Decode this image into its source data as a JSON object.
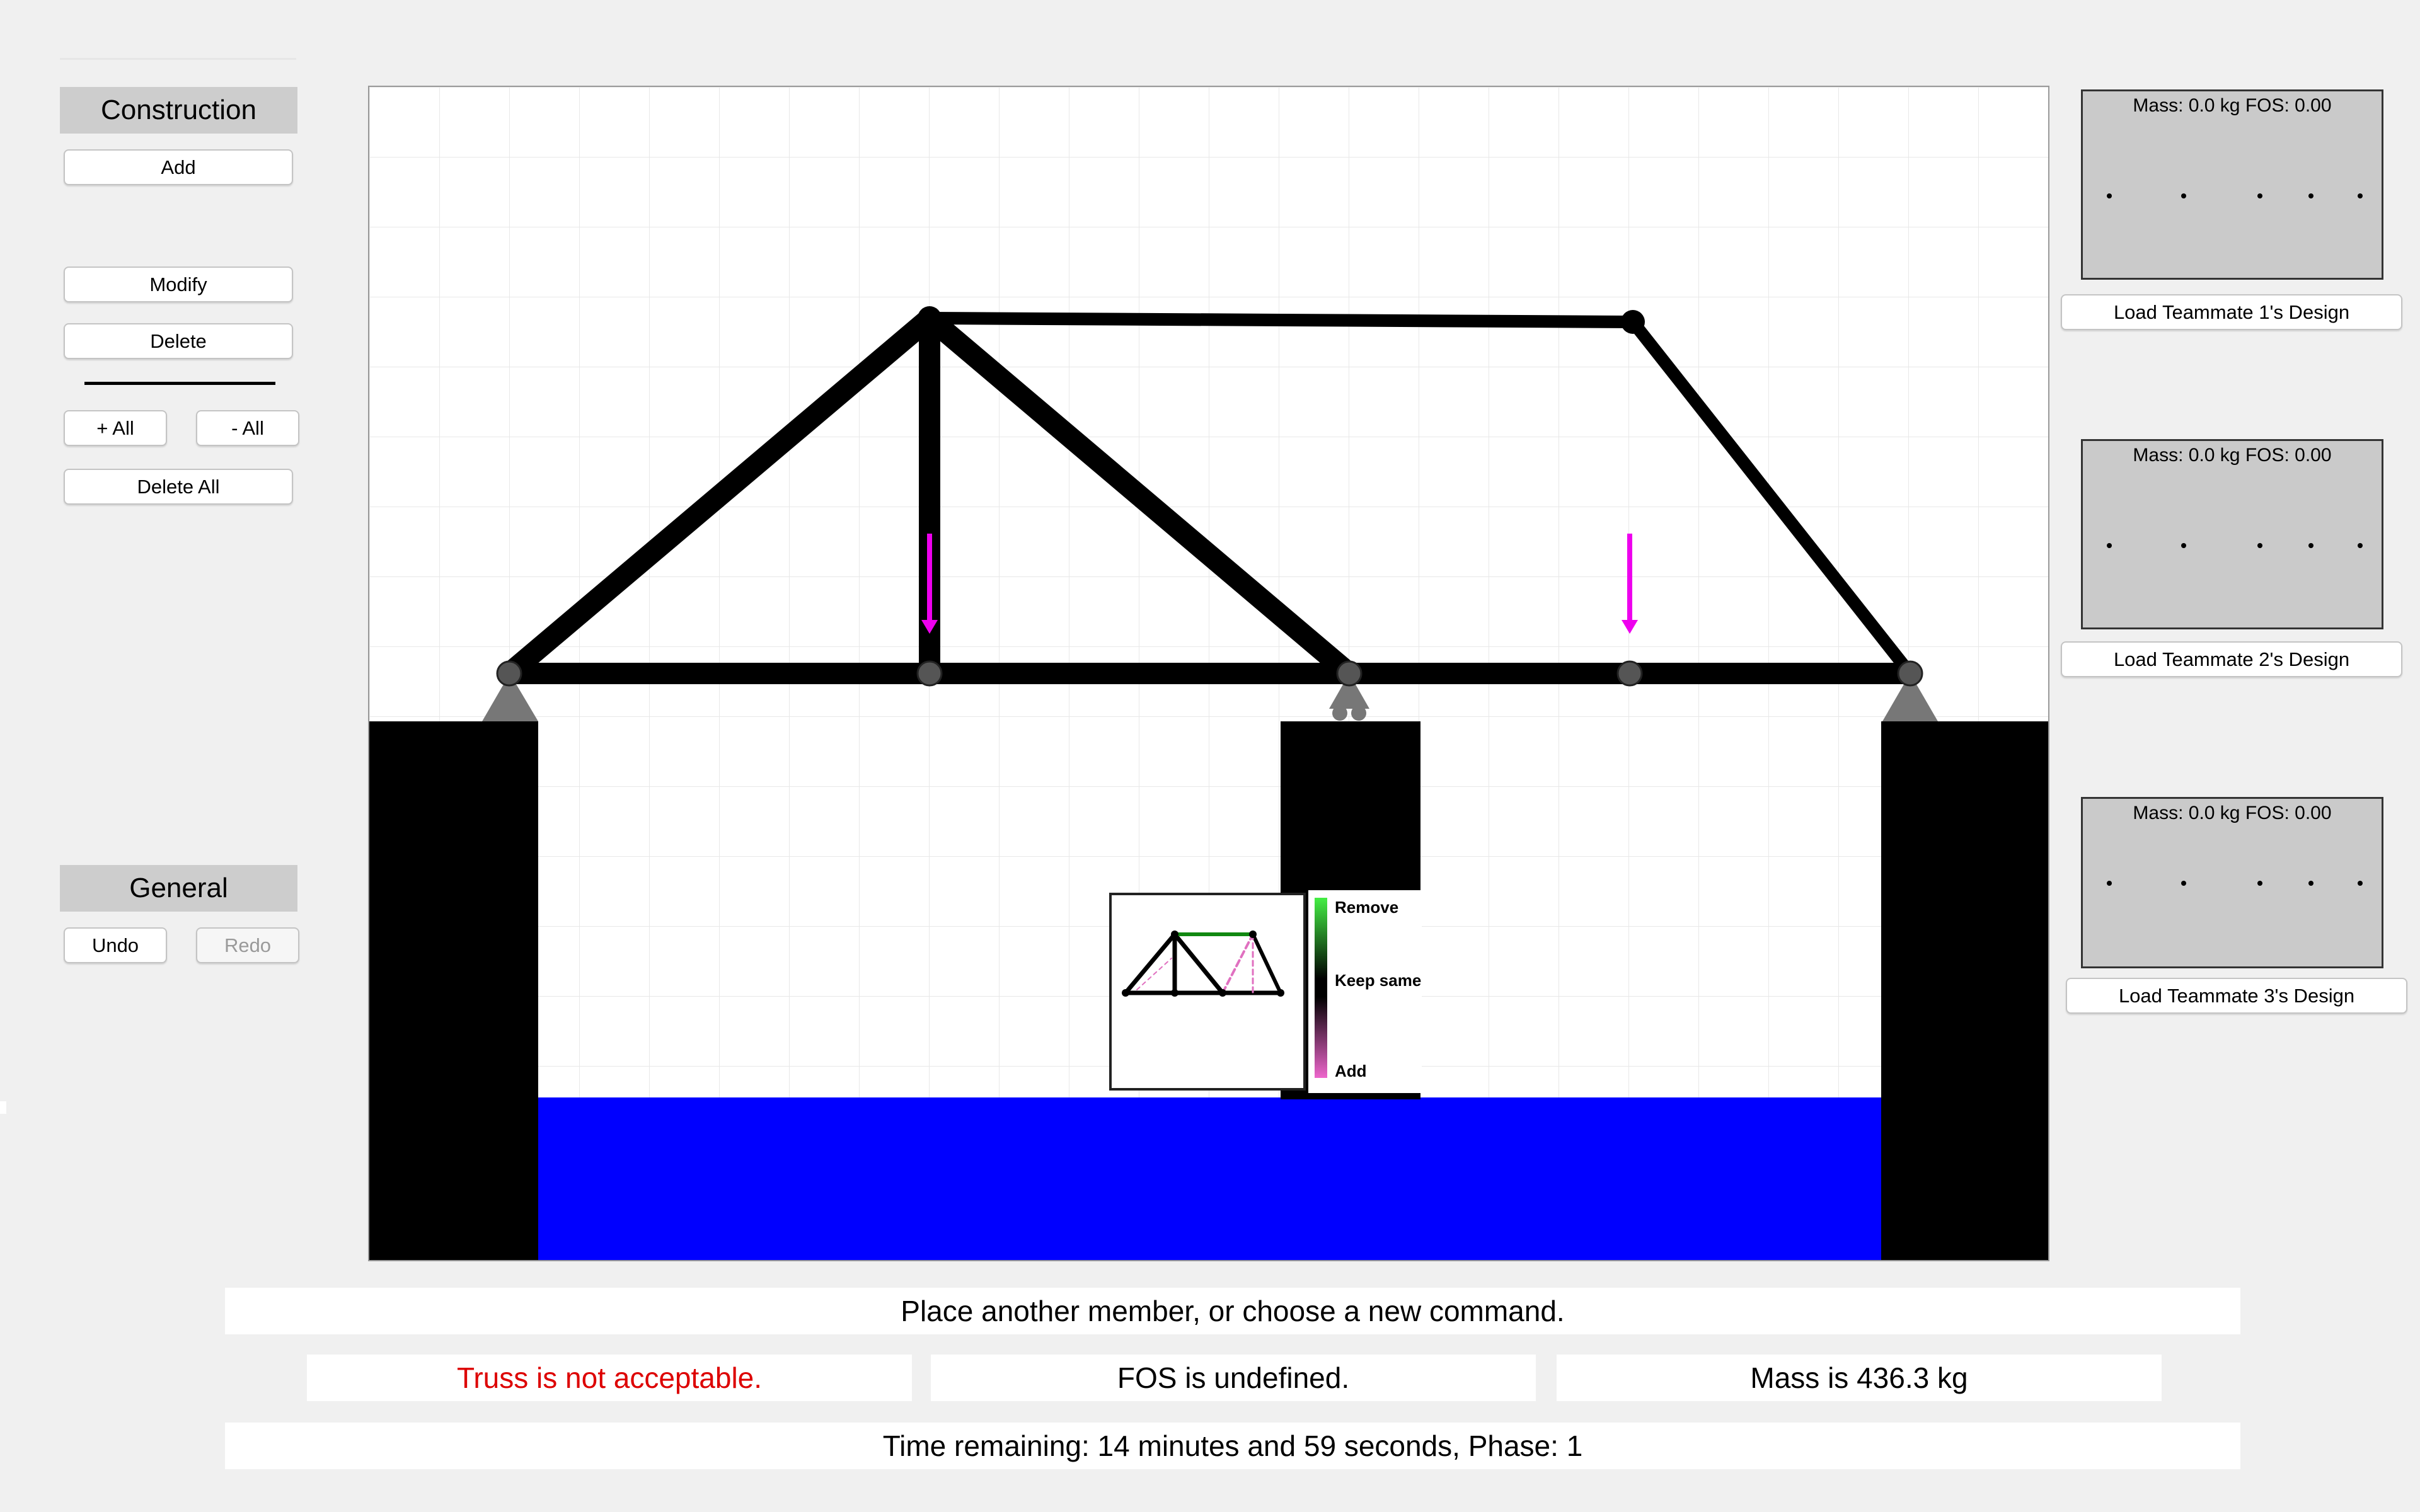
{
  "sidebar": {
    "construction_title": "Construction",
    "add_label": "Add",
    "modify_label": "Modify",
    "delete_label": "Delete",
    "plus_all_label": "+ All",
    "minus_all_label": "- All",
    "delete_all_label": "Delete All",
    "general_title": "General",
    "undo_label": "Undo",
    "redo_label": "Redo"
  },
  "teammates": [
    {
      "stats": "Mass: 0.0 kg FOS: 0.00",
      "button": "Load Teammate 1's Design"
    },
    {
      "stats": "Mass: 0.0 kg FOS: 0.00",
      "button": "Load Teammate 2's Design"
    },
    {
      "stats": "Mass: 0.0 kg FOS: 0.00",
      "button": "Load Teammate 3's Design"
    }
  ],
  "legend": {
    "remove": "Remove",
    "keep_same": "Keep same",
    "add": "Add"
  },
  "status": {
    "instruction": "Place another member, or choose a new command.",
    "acceptability": "Truss is not acceptable.",
    "fos": "FOS is undefined.",
    "mass": "Mass is 436.3 kg",
    "timer": "Time remaining: 14 minutes and 59 seconds, Phase: 1"
  },
  "colors": {
    "water": "#0000ff",
    "load_arrow": "#ee00ee",
    "not_acceptable_text": "#dd0000",
    "member": "#000000",
    "joint": "#555555"
  }
}
